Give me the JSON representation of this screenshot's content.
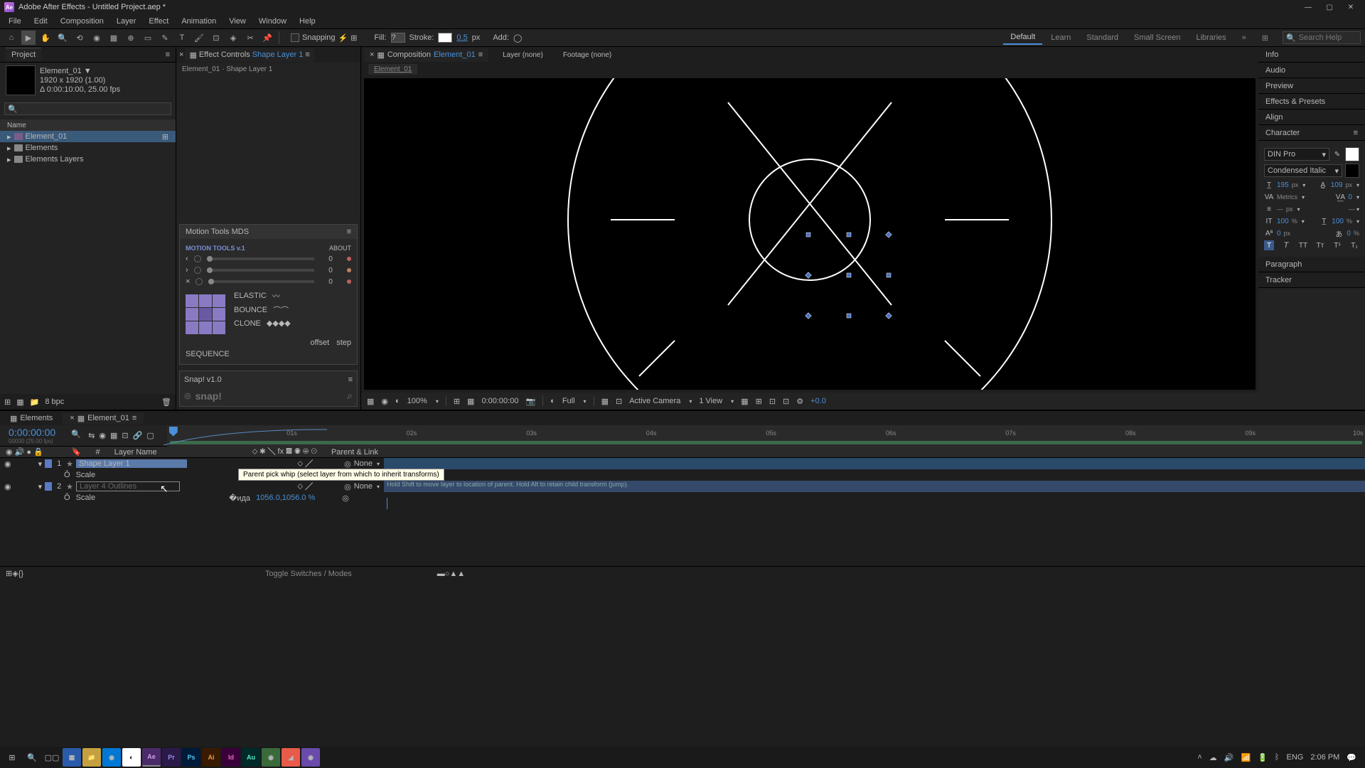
{
  "title_bar": {
    "app": "Adobe After Effects - Untitled Project.aep *"
  },
  "menu": [
    "File",
    "Edit",
    "Composition",
    "Layer",
    "Effect",
    "Animation",
    "View",
    "Window",
    "Help"
  ],
  "toolbar": {
    "snapping": "Snapping",
    "fill": "Fill:",
    "stroke": "Stroke:",
    "stroke_val": "0.5",
    "stroke_unit": "px",
    "add": "Add:"
  },
  "workspaces": [
    "Default",
    "Learn",
    "Standard",
    "Small Screen",
    "Libraries"
  ],
  "search_placeholder": "Search Help",
  "project": {
    "tab": "Project",
    "item_name": "Element_01",
    "item_dim": "1920 x 1920 (1.00)",
    "item_dur": "Δ 0:00:10:00, 25.00 fps",
    "col_name": "Name",
    "items": [
      "Element_01",
      "Elements",
      "Elements Layers"
    ],
    "bpc": "8 bpc"
  },
  "effect_controls": {
    "tab": "Effect Controls",
    "layer": "Shape Layer 1",
    "header": "Element_01 · Shape Layer 1"
  },
  "motion_tools": {
    "title": "Motion Tools MDS",
    "brand": "MOTION TOOLS v.1",
    "about": "ABOUT",
    "vals": [
      "0",
      "0",
      "0"
    ],
    "elastic": "ELASTIC",
    "bounce": "BOUNCE",
    "clone": "CLONE",
    "offset": "offset",
    "step": "step",
    "sequence": "SEQUENCE"
  },
  "snap": {
    "title": "Snap! v1.0",
    "logo": "snap!"
  },
  "viewer": {
    "comp_tab": "Composition",
    "comp_name": "Element_01",
    "layer_tab": "Layer (none)",
    "footage_tab": "Footage (none)",
    "subtab": "Element_01",
    "zoom": "100%",
    "time": "0:00:00:00",
    "res": "Full",
    "camera": "Active Camera",
    "view": "1 View",
    "exp": "+0.0"
  },
  "right": {
    "info": "Info",
    "audio": "Audio",
    "preview": "Preview",
    "ep": "Effects & Presets",
    "align": "Align",
    "character": "Character",
    "paragraph": "Paragraph",
    "tracker": "Tracker",
    "font": "DIN Pro",
    "style": "Condensed Italic",
    "size": "195",
    "size_u": "px",
    "leading": "109",
    "leading_u": "px",
    "kerning": "Metrics",
    "tracking": "0",
    "stroke_u": "px",
    "vscale": "100",
    "vscale_u": "%",
    "hscale": "100",
    "hscale_u": "%",
    "baseline": "0",
    "baseline_u": "px",
    "tsume": "0",
    "tsume_u": "%"
  },
  "timeline": {
    "tabs": [
      "Elements",
      "Element_01"
    ],
    "time": "0:00:00:00",
    "frame": "00000 (25.00 fps)",
    "col_layer": "Layer Name",
    "col_parent": "Parent & Link",
    "marks": [
      "01s",
      "02s",
      "03s",
      "04s",
      "05s",
      "06s",
      "07s",
      "08s",
      "09s",
      "10s"
    ],
    "layer1": {
      "num": "1",
      "name": "Shape Layer 1",
      "parent": "None",
      "prop": "Scale"
    },
    "layer2": {
      "num": "2",
      "name": "Layer 4 Outlines",
      "parent": "None",
      "prop": "Scale",
      "scale": "1056.0,1056.0 %"
    },
    "tooltip": "Parent pick whip (select layer from which to inherit transforms)",
    "hint": "Hold Shift to move layer to location of parent. Hold Alt to retain child transform (jump).",
    "footer": "Toggle Switches / Modes"
  },
  "taskbar": {
    "lang": "ENG",
    "time": "2:06 PM"
  }
}
